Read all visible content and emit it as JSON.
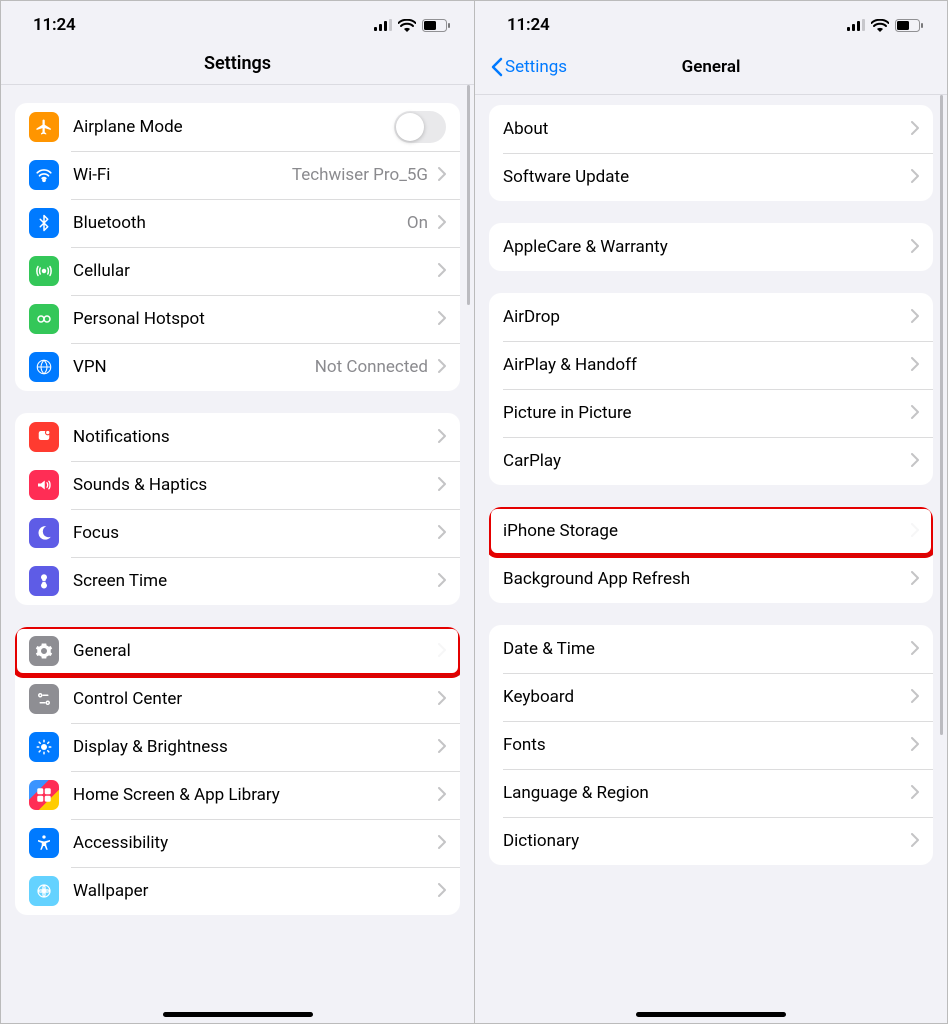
{
  "status": {
    "time": "11:24"
  },
  "left": {
    "title": "Settings",
    "groups": [
      {
        "rows": [
          {
            "icon": "airplane-icon",
            "bg": "bg-orange",
            "label": "Airplane Mode",
            "kind": "toggle",
            "state": false
          },
          {
            "icon": "wifi-icon",
            "bg": "bg-blue",
            "label": "Wi-Fi",
            "kind": "link",
            "value": "Techwiser Pro_5G"
          },
          {
            "icon": "bluetooth-icon",
            "bg": "bg-blue",
            "label": "Bluetooth",
            "kind": "link",
            "value": "On"
          },
          {
            "icon": "cellular-icon",
            "bg": "bg-green",
            "label": "Cellular",
            "kind": "link"
          },
          {
            "icon": "hotspot-icon",
            "bg": "bg-green",
            "label": "Personal Hotspot",
            "kind": "link"
          },
          {
            "icon": "vpn-icon",
            "bg": "bg-blue",
            "label": "VPN",
            "kind": "link",
            "value": "Not Connected"
          }
        ]
      },
      {
        "rows": [
          {
            "icon": "notifications-icon",
            "bg": "bg-red",
            "label": "Notifications",
            "kind": "link"
          },
          {
            "icon": "sounds-icon",
            "bg": "bg-pink",
            "label": "Sounds & Haptics",
            "kind": "link"
          },
          {
            "icon": "focus-icon",
            "bg": "bg-indigo",
            "label": "Focus",
            "kind": "link"
          },
          {
            "icon": "screentime-icon",
            "bg": "bg-indigo",
            "label": "Screen Time",
            "kind": "link"
          }
        ]
      },
      {
        "rows": [
          {
            "icon": "gear-icon",
            "bg": "bg-gray",
            "label": "General",
            "kind": "link",
            "highlight": true
          },
          {
            "icon": "control-center-icon",
            "bg": "bg-gray",
            "label": "Control Center",
            "kind": "link"
          },
          {
            "icon": "display-icon",
            "bg": "bg-blue",
            "label": "Display & Brightness",
            "kind": "link"
          },
          {
            "icon": "home-screen-icon",
            "bg": "bg-multi",
            "label": "Home Screen & App Library",
            "kind": "link"
          },
          {
            "icon": "accessibility-icon",
            "bg": "bg-blue",
            "label": "Accessibility",
            "kind": "link"
          },
          {
            "icon": "wallpaper-icon",
            "bg": "bg-cyan",
            "label": "Wallpaper",
            "kind": "link"
          }
        ]
      }
    ]
  },
  "right": {
    "back": "Settings",
    "title": "General",
    "groups": [
      {
        "rows": [
          {
            "label": "About",
            "kind": "link"
          },
          {
            "label": "Software Update",
            "kind": "link"
          }
        ]
      },
      {
        "rows": [
          {
            "label": "AppleCare & Warranty",
            "kind": "link"
          }
        ]
      },
      {
        "rows": [
          {
            "label": "AirDrop",
            "kind": "link"
          },
          {
            "label": "AirPlay & Handoff",
            "kind": "link"
          },
          {
            "label": "Picture in Picture",
            "kind": "link"
          },
          {
            "label": "CarPlay",
            "kind": "link"
          }
        ]
      },
      {
        "rows": [
          {
            "label": "iPhone Storage",
            "kind": "link",
            "highlight": true
          },
          {
            "label": "Background App Refresh",
            "kind": "link"
          }
        ]
      },
      {
        "rows": [
          {
            "label": "Date & Time",
            "kind": "link"
          },
          {
            "label": "Keyboard",
            "kind": "link"
          },
          {
            "label": "Fonts",
            "kind": "link"
          },
          {
            "label": "Language & Region",
            "kind": "link"
          },
          {
            "label": "Dictionary",
            "kind": "link"
          }
        ]
      }
    ]
  }
}
